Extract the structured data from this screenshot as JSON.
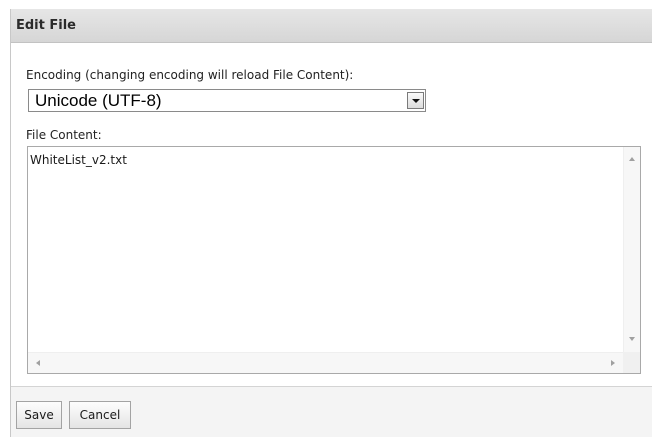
{
  "panel": {
    "title": "Edit File"
  },
  "encoding": {
    "label": "Encoding (changing encoding will reload File Content):",
    "selected": "Unicode (UTF-8)"
  },
  "file_content": {
    "label": "File Content:",
    "value": "WhiteList_v2.txt"
  },
  "footer": {
    "save_label": "Save",
    "cancel_label": "Cancel"
  }
}
